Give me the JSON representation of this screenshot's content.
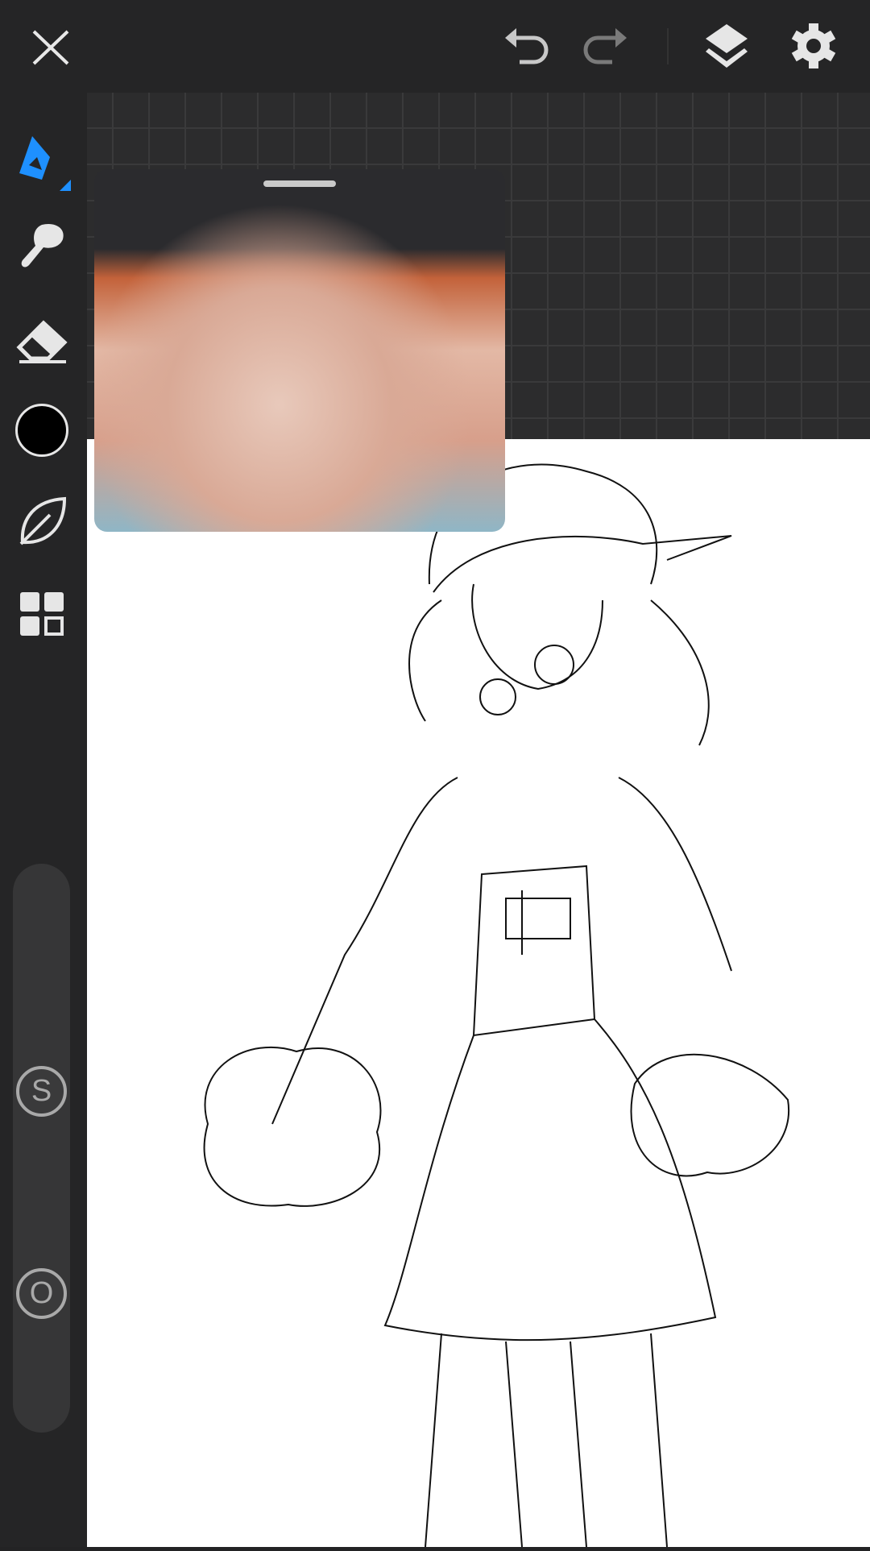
{
  "topbar": {
    "close": "close-icon",
    "undo": "undo-icon",
    "redo": "redo-icon",
    "layers": "layers-icon",
    "settings": "gear-icon"
  },
  "tools": [
    "pen",
    "brush",
    "eraser",
    "color",
    "leaf",
    "grid"
  ],
  "colors": {
    "accent": "#1e90ff",
    "current_color": "#000000",
    "bg": "#252526"
  },
  "sliders": {
    "size_label": "S",
    "opacity_label": "O"
  }
}
